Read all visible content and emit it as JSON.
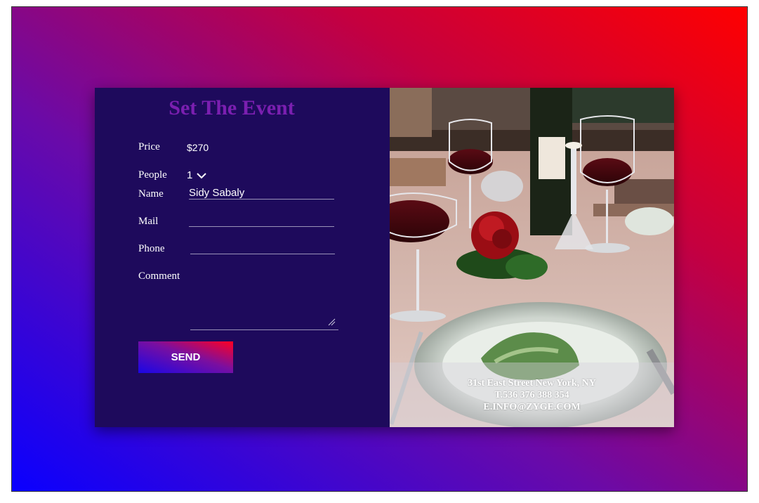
{
  "form": {
    "title": "Set The Event",
    "price_label": "Price",
    "price_value": "$270",
    "people_label": "People",
    "people_value": "1",
    "name_label": "Name",
    "name_value": "Sidy Sabaly",
    "mail_label": "Mail",
    "mail_value": "",
    "phone_label": "Phone",
    "phone_value": "",
    "comment_label": "Comment",
    "comment_value": "",
    "send_label": "SEND"
  },
  "contact": {
    "address": "31st East Street New York, NY",
    "phone": "T.536 376 388 354",
    "email": "E.INFO@ZYGE.COM"
  },
  "icons": {
    "people_dropdown": "chevron-down-icon",
    "comment_resize": "resize-grip-icon"
  },
  "colors": {
    "background_gradient_start": "#0a00ff",
    "background_gradient_end": "#ff0000",
    "form_panel": "#1e0a5c",
    "title": "#7b1fb0"
  }
}
